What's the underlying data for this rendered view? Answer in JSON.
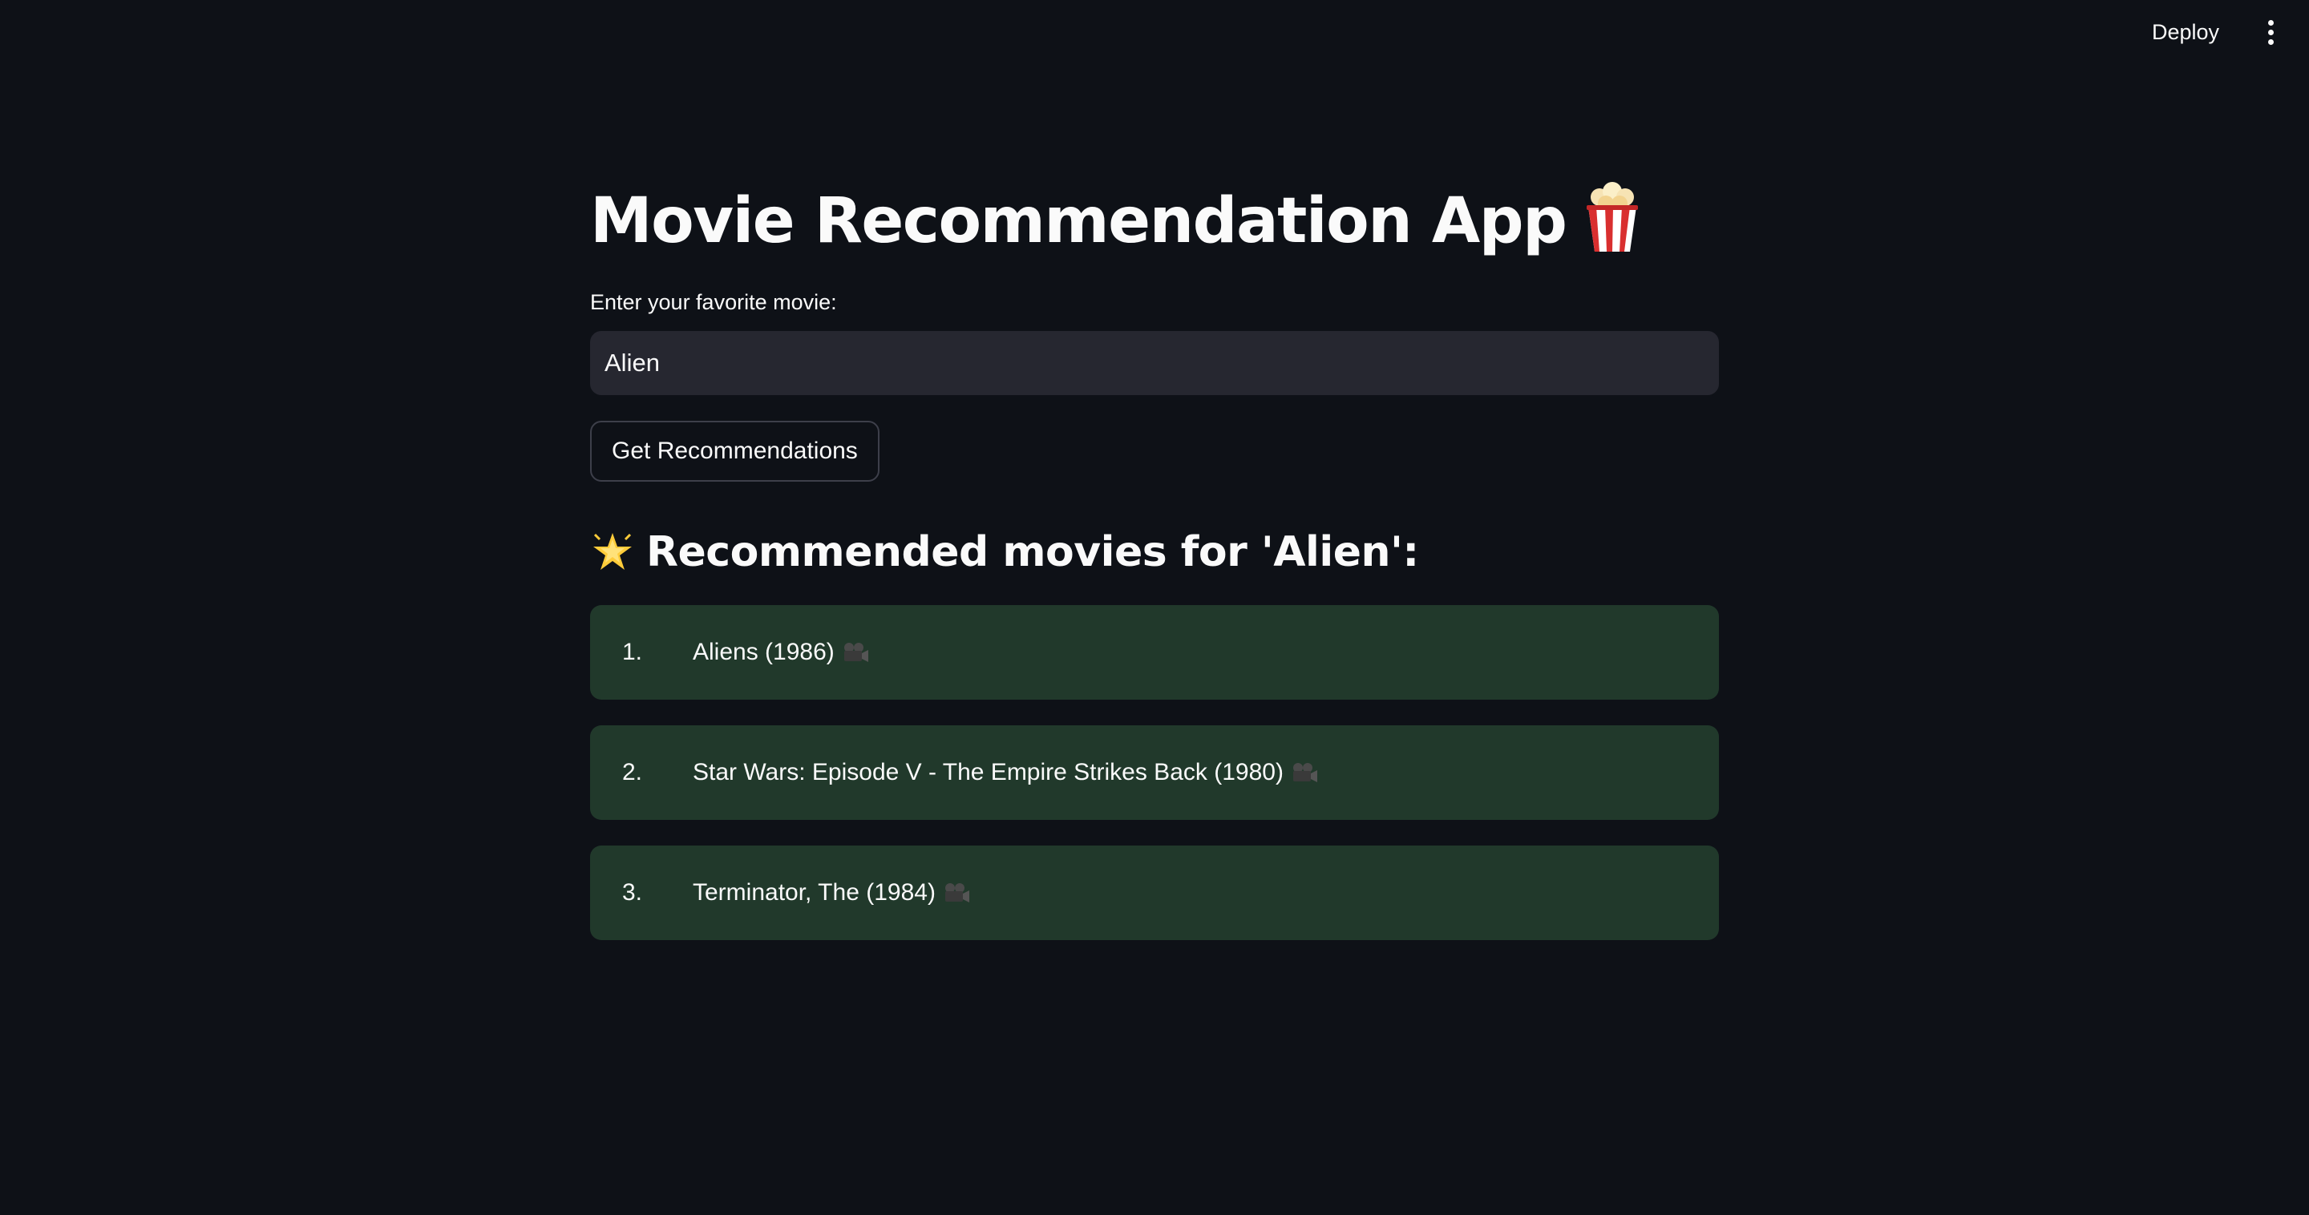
{
  "header": {
    "deploy_label": "Deploy",
    "menu_icon": "more-vertical-icon"
  },
  "main": {
    "title": "Movie Recommendation App",
    "title_icon": "popcorn-icon",
    "input_label": "Enter your favorite movie:",
    "input_value": "Alien",
    "button_label": "Get Recommendations",
    "results_heading": "Recommended movies for 'Alien':",
    "results_heading_icon": "glowing-star-icon",
    "results": [
      {
        "index": "1.",
        "title": "Aliens (1986)",
        "icon": "movie-camera-icon"
      },
      {
        "index": "2.",
        "title": "Star Wars: Episode V - The Empire Strikes Back (1980)",
        "icon": "movie-camera-icon"
      },
      {
        "index": "3.",
        "title": "Terminator, The (1984)",
        "icon": "movie-camera-icon"
      }
    ]
  },
  "colors": {
    "background": "#0e1117",
    "input_background": "#262730",
    "success_background": "#21392b",
    "text": "#fafafa"
  }
}
